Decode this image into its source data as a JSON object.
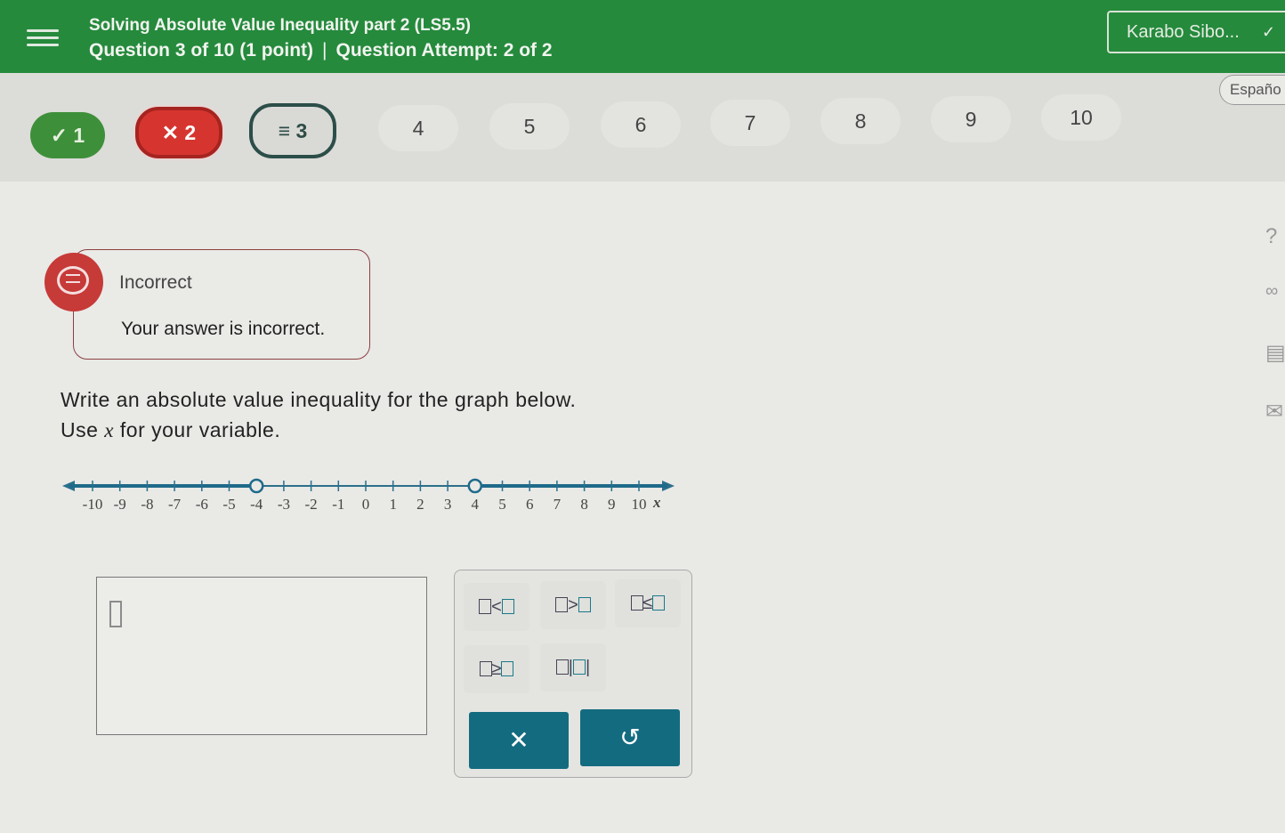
{
  "header": {
    "title": "Solving Absolute Value Inequality part 2 (LS5.5)",
    "question_info": "Question 3 of 10 (1 point)",
    "separator": "|",
    "attempt": "Question Attempt: 2 of 2",
    "user": "Karabo Sibo...",
    "background": "#258a3c"
  },
  "nav": {
    "language": "Españo",
    "questions": [
      {
        "label": "✓ 1",
        "status": "correct"
      },
      {
        "label": "✕ 2",
        "status": "incorrect"
      },
      {
        "label": "≡ 3",
        "status": "current"
      },
      {
        "label": "4"
      },
      {
        "label": "5"
      },
      {
        "label": "6"
      },
      {
        "label": "7"
      },
      {
        "label": "8"
      },
      {
        "label": "9"
      },
      {
        "label": "10"
      }
    ]
  },
  "feedback": {
    "title": "Incorrect",
    "text": "Your answer is incorrect."
  },
  "question": {
    "line1": "Write an absolute value inequality for the graph below.",
    "line2_prefix": "Use ",
    "variable": "x",
    "line2_suffix": " for your variable."
  },
  "number_line": {
    "ticks": [
      "-10",
      "-9",
      "-8",
      "-7",
      "-6",
      "-5",
      "-4",
      "-3",
      "-2",
      "-1",
      "0",
      "1",
      "2",
      "3",
      "4",
      "5",
      "6",
      "7",
      "8",
      "9",
      "10"
    ],
    "axis_label": "x",
    "open_points": [
      -4,
      4
    ],
    "shaded": "x < -4 or x > 4"
  },
  "tools": {
    "lt": "<",
    "gt": ">",
    "le": "≤",
    "ge": "≥",
    "abs": "|",
    "clear_icon": "close-icon",
    "undo_icon": "undo-icon"
  },
  "side_icons": [
    "help-icon",
    "glasses-icon",
    "calculator-icon",
    "mail-icon"
  ]
}
